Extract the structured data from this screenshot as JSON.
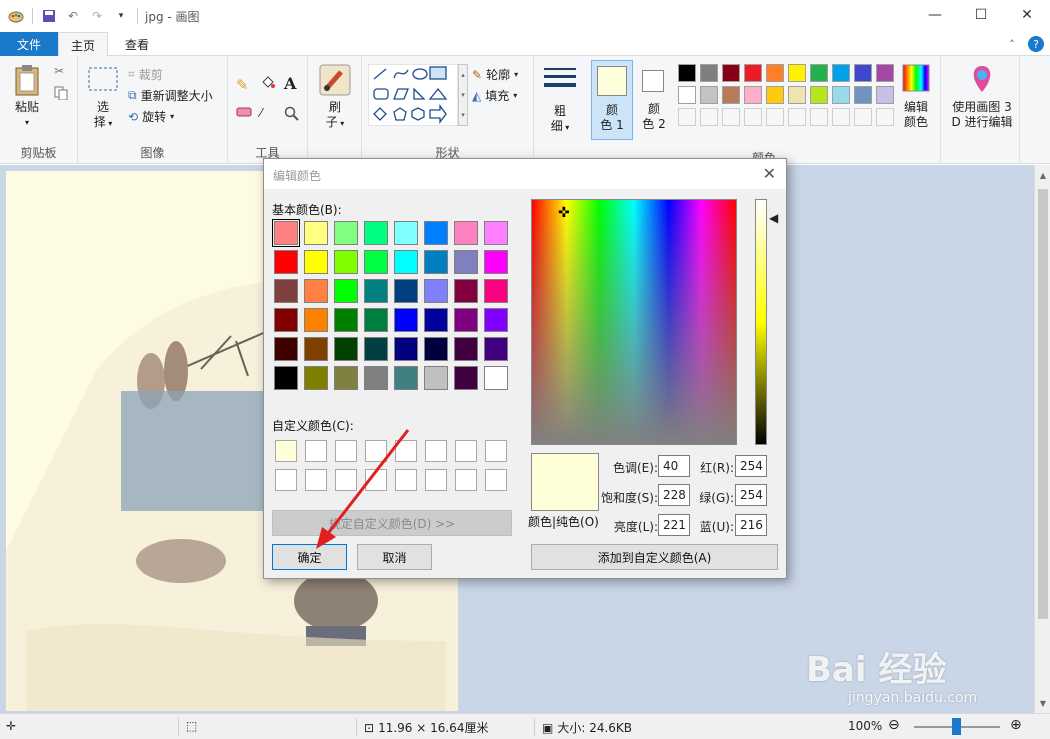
{
  "window": {
    "title": "jpg - 画图",
    "minimize_glyph": "—",
    "maximize_glyph": "☐",
    "close_glyph": "✕"
  },
  "tabs": [
    {
      "label": "文件"
    },
    {
      "label": "主页"
    },
    {
      "label": "查看"
    }
  ],
  "ribbon": {
    "clipboard": {
      "label": "剪贴板",
      "paste": "粘贴"
    },
    "image": {
      "label": "图像",
      "select_l1": "选",
      "select_l2": "择",
      "crop": "裁剪",
      "resize": "重新调整大小",
      "rotate": "旋转"
    },
    "tools": {
      "label": "工具"
    },
    "brush": {
      "l1": "刷",
      "l2": "子"
    },
    "shapes": {
      "label": "形状",
      "outline": "轮廓",
      "fill": "填充"
    },
    "size": {
      "l1": "粗",
      "l2": "细"
    },
    "color1": {
      "l1": "颜",
      "l2": "色 1"
    },
    "color2": {
      "l1": "颜",
      "l2": "色 2"
    },
    "colors": {
      "label": "颜色"
    },
    "edit_colors": {
      "l1": "编辑",
      "l2": "颜色"
    },
    "paint3d": {
      "l1": "使用画图 3",
      "l2": "D 进行编辑"
    },
    "color1_value": "#fefedc",
    "palette_row1": [
      "#000000",
      "#7f7f7f",
      "#880015",
      "#ed1c24",
      "#ff7f27",
      "#fff200",
      "#22b14c",
      "#00a2e8",
      "#3f48cc",
      "#a349a4"
    ],
    "palette_row2": [
      "#ffffff",
      "#c3c3c3",
      "#b97a57",
      "#ffaec9",
      "#ffc90e",
      "#efe4b0",
      "#b5e61d",
      "#99d9ea",
      "#7092be",
      "#c8bfe7"
    ]
  },
  "status": {
    "size": "11.96 × 16.64厘米",
    "filesize": "大小: 24.6KB",
    "zoom": "100%"
  },
  "dialog": {
    "title": "编辑颜色",
    "basic_label": "基本颜色(B):",
    "custom_label": "自定义颜色(C):",
    "define_custom": "规定自定义颜色(D) >>",
    "ok": "确定",
    "cancel": "取消",
    "preview_label": "颜色|纯色(O)",
    "add_custom": "添加到自定义颜色(A)",
    "fields": {
      "hue_label": "色调(E):",
      "hue": "40",
      "sat_label": "饱和度(S):",
      "sat": "228",
      "lum_label": "亮度(L):",
      "lum": "221",
      "red_label": "红(R):",
      "red": "254",
      "green_label": "绿(G):",
      "green": "254",
      "blue_label": "蓝(U):",
      "blue": "216"
    },
    "selected_color": "#fefed8",
    "basic_colors": [
      [
        "#ff8080",
        "#ffff80",
        "#80ff80",
        "#00ff80",
        "#80ffff",
        "#0080ff",
        "#ff80c0",
        "#ff80ff"
      ],
      [
        "#ff0000",
        "#ffff00",
        "#80ff00",
        "#00ff40",
        "#00ffff",
        "#0080c0",
        "#8080c0",
        "#ff00ff"
      ],
      [
        "#804040",
        "#ff8040",
        "#00ff00",
        "#008080",
        "#004080",
        "#8080ff",
        "#800040",
        "#ff0080"
      ],
      [
        "#800000",
        "#ff8000",
        "#008000",
        "#008040",
        "#0000ff",
        "#0000a0",
        "#800080",
        "#8000ff"
      ],
      [
        "#400000",
        "#804000",
        "#004000",
        "#004040",
        "#000080",
        "#000040",
        "#400040",
        "#400080"
      ],
      [
        "#000000",
        "#808000",
        "#808040",
        "#808080",
        "#408080",
        "#c0c0c0",
        "#400040",
        "#ffffff"
      ]
    ],
    "custom_colors": [
      "#fefed8",
      "#ffffff",
      "#ffffff",
      "#ffffff",
      "#ffffff",
      "#ffffff",
      "#ffffff",
      "#ffffff",
      "#ffffff",
      "#ffffff",
      "#ffffff",
      "#ffffff",
      "#ffffff",
      "#ffffff",
      "#ffffff",
      "#ffffff"
    ]
  },
  "watermark": {
    "brand": "Bai  经验",
    "url": "jingyan.baidu.com"
  }
}
